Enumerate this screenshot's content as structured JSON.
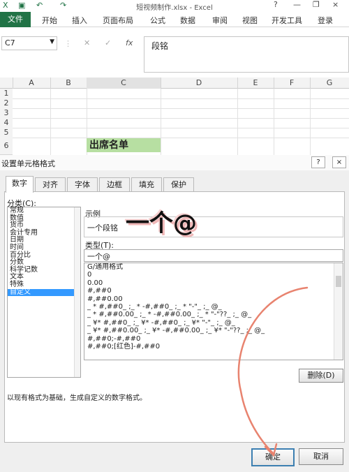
{
  "window": {
    "title": "短视频制作.xlsx - Excel",
    "controls": [
      "?",
      "—",
      "❐",
      "×"
    ]
  },
  "ribbon": {
    "tabs": [
      "文件",
      "开始",
      "插入",
      "页面布局",
      "公式",
      "数据",
      "审阅",
      "视图",
      "开发工具"
    ],
    "login": "登录"
  },
  "formula_bar": {
    "name_box": "C7",
    "fx": "fx",
    "content": "段铭"
  },
  "sheet": {
    "columns": [
      "A",
      "B",
      "C",
      "D",
      "E",
      "F",
      "G"
    ],
    "rows": [
      "1",
      "2",
      "3",
      "4",
      "5",
      "6"
    ],
    "c6_text": "出席名单",
    "header_fill": "#b7dfa2"
  },
  "dialog": {
    "title": "设置单元格格式",
    "help": "?",
    "close": "×",
    "tabs": [
      "数字",
      "对齐",
      "字体",
      "边框",
      "填充",
      "保护"
    ],
    "active_tab": "数字",
    "category_label": "分类(C):",
    "categories": [
      "常规",
      "数值",
      "货币",
      "会计专用",
      "日期",
      "时间",
      "百分比",
      "分数",
      "科学记数",
      "文本",
      "特殊",
      "自定义"
    ],
    "selected_category": "自定义",
    "sample_label": "示例",
    "sample_value": "一个段铭",
    "type_label": "类型(T):",
    "type_value": "一个@",
    "formats": [
      "G/通用格式",
      "0",
      "0.00",
      "#,##0",
      "#,##0.00",
      "_ * #,##0_ ;_ * -#,##0_ ;_ * \"-\"_ ;_ @_",
      "_ * #,##0.00_ ;_ * -#,##0.00_ ;_ * \"-\"??_ ;_ @_",
      "_ ¥* #,##0_ ;_ ¥* -#,##0_ ;_ ¥* \"-\"_ ;_ @_",
      "_ ¥* #,##0.00_ ;_ ¥* -#,##0.00_ ;_ ¥* \"-\"??_ ;_ @_",
      "#,##0;-#,##0",
      "#,##0;[红色]-#,##0"
    ],
    "delete_button": "删除(D)",
    "description": "以现有格式为基础，生成自定义的数字格式。",
    "ok_button": "确定",
    "cancel_button": "取消"
  },
  "annotation": {
    "overlay_text": "一个@"
  }
}
